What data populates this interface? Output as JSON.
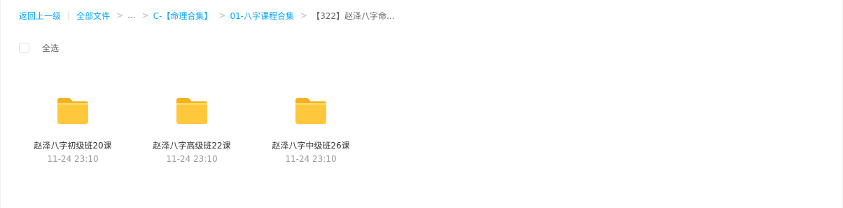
{
  "breadcrumb": {
    "back_label": "返回上一级",
    "all_files_label": "全部文件",
    "ellipsis": "...",
    "items": [
      "C-【命理合集】",
      "01-八字课程合集",
      "【322】赵泽八字命..."
    ]
  },
  "select_all": {
    "label": "全选"
  },
  "folders": [
    {
      "name": "赵泽八字初级班20课",
      "time": "11-24 23:10"
    },
    {
      "name": "赵泽八字高级班22课",
      "time": "11-24 23:10"
    },
    {
      "name": "赵泽八字中级班26课",
      "time": "11-24 23:10"
    }
  ],
  "colors": {
    "link": "#06a7ff",
    "folder_body": "#ffc73b",
    "folder_tab": "#f5b21f"
  },
  "icons": {
    "folder": "folder-icon",
    "checkbox": "checkbox-icon"
  }
}
